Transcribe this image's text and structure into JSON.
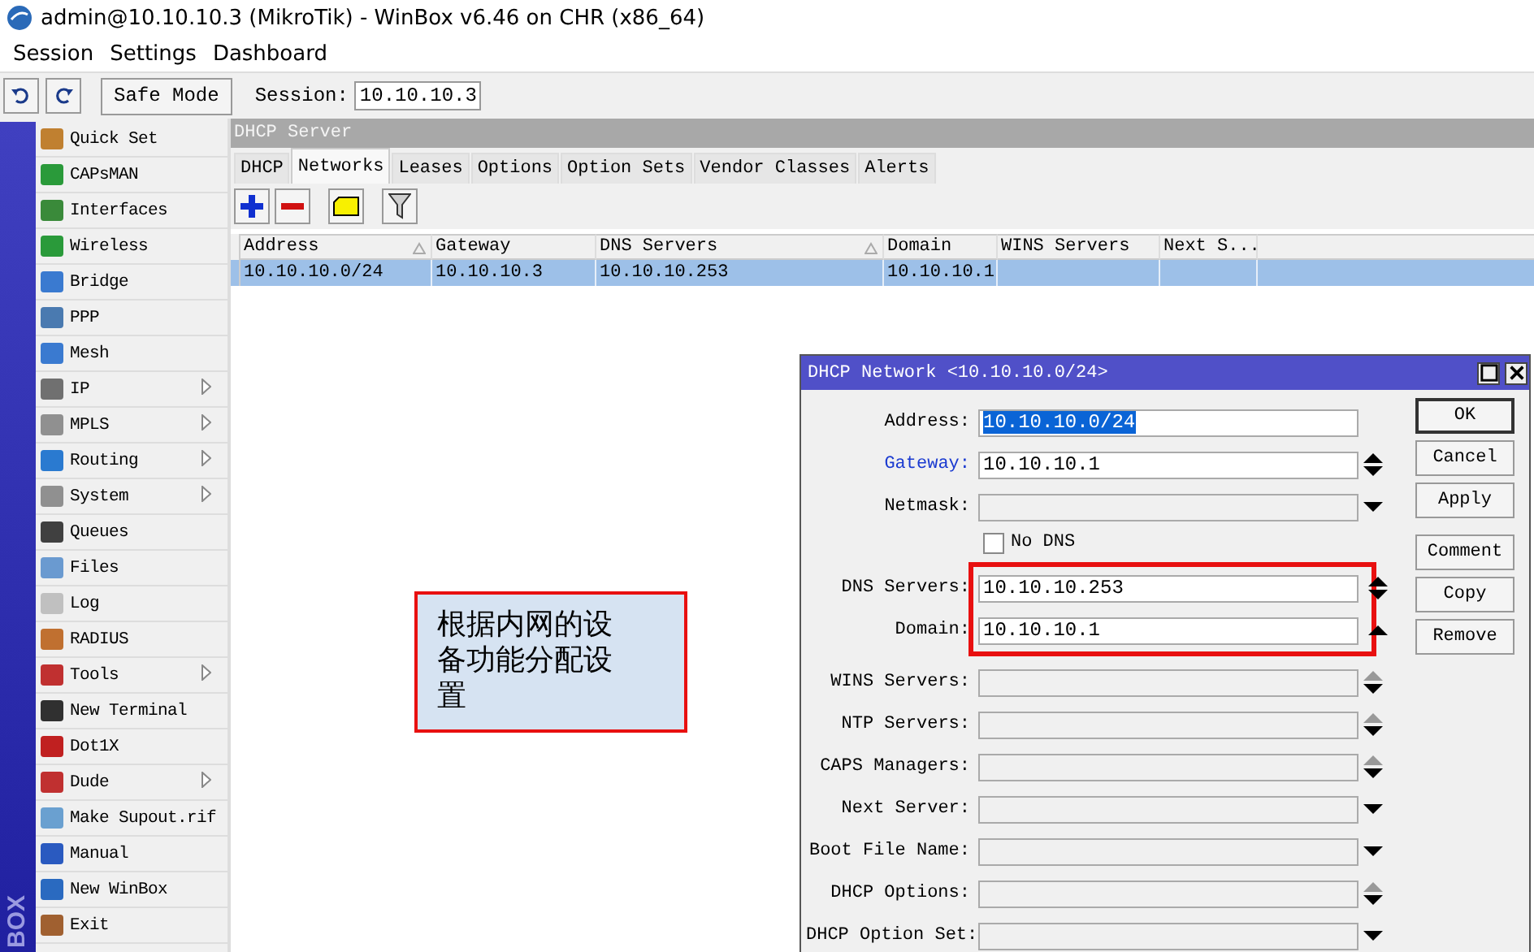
{
  "window": {
    "title": "admin@10.10.10.3 (MikroTik) - WinBox v6.46 on CHR (x86_64)"
  },
  "menu": [
    "Session",
    "Settings",
    "Dashboard"
  ],
  "toolbar": {
    "safe_mode": "Safe Mode",
    "session_label": "Session:",
    "session_value": "10.10.10.3"
  },
  "sidebar": {
    "brand": "BOX",
    "items": [
      {
        "label": "Quick Set",
        "submenu": false
      },
      {
        "label": "CAPsMAN",
        "submenu": false
      },
      {
        "label": "Interfaces",
        "submenu": false
      },
      {
        "label": "Wireless",
        "submenu": false
      },
      {
        "label": "Bridge",
        "submenu": false
      },
      {
        "label": "PPP",
        "submenu": false
      },
      {
        "label": "Mesh",
        "submenu": false
      },
      {
        "label": "IP",
        "submenu": true
      },
      {
        "label": "MPLS",
        "submenu": true
      },
      {
        "label": "Routing",
        "submenu": true
      },
      {
        "label": "System",
        "submenu": true
      },
      {
        "label": "Queues",
        "submenu": false
      },
      {
        "label": "Files",
        "submenu": false
      },
      {
        "label": "Log",
        "submenu": false
      },
      {
        "label": "RADIUS",
        "submenu": false
      },
      {
        "label": "Tools",
        "submenu": true
      },
      {
        "label": "New Terminal",
        "submenu": false
      },
      {
        "label": "Dot1X",
        "submenu": false
      },
      {
        "label": "Dude",
        "submenu": true
      },
      {
        "label": "Make Supout.rif",
        "submenu": false
      },
      {
        "label": "Manual",
        "submenu": false
      },
      {
        "label": "New WinBox",
        "submenu": false
      },
      {
        "label": "Exit",
        "submenu": false
      }
    ]
  },
  "panel": {
    "title": "DHCP Server",
    "tabs": [
      {
        "label": "DHCP",
        "selected": false
      },
      {
        "label": "Networks",
        "selected": true
      },
      {
        "label": "Leases",
        "selected": false
      },
      {
        "label": "Options",
        "selected": false
      },
      {
        "label": "Option Sets",
        "selected": false
      },
      {
        "label": "Vendor Classes",
        "selected": false
      },
      {
        "label": "Alerts",
        "selected": false
      }
    ],
    "table": {
      "columns": [
        {
          "label": "Address",
          "sorted": true
        },
        {
          "label": "Gateway",
          "sorted": false
        },
        {
          "label": "DNS Servers",
          "sorted": true
        },
        {
          "label": "Domain",
          "sorted": false
        },
        {
          "label": "WINS Servers",
          "sorted": false
        },
        {
          "label": "Next S...",
          "sorted": false
        }
      ],
      "rows": [
        {
          "selected": true,
          "cells": [
            "10.10.10.0/24",
            "10.10.10.3",
            "10.10.10.253",
            "10.10.10.1",
            "",
            ""
          ]
        }
      ]
    }
  },
  "callout": {
    "text": "根据内网的设备功能分配设置"
  },
  "dialog": {
    "title": "DHCP Network <10.10.10.0/24>",
    "sections": [
      {
        "highlighted": false,
        "fields": [
          {
            "kind": "text",
            "label": "Address:",
            "link": false,
            "value": "10.10.10.0/24",
            "value_selected": true,
            "enabled": true,
            "up_arrow": false,
            "down_arrow": false
          },
          {
            "kind": "text",
            "label": "Gateway:",
            "link": true,
            "value": "10.10.10.1",
            "value_selected": false,
            "enabled": true,
            "up_arrow": true,
            "up_enabled": true,
            "down_arrow": true
          },
          {
            "kind": "text",
            "label": "Netmask:",
            "link": false,
            "enabled": false,
            "up_arrow": false,
            "down_arrow": true
          },
          {
            "kind": "checkbox",
            "label": "No DNS",
            "checked": false
          }
        ]
      },
      {
        "highlighted": true,
        "fields": [
          {
            "kind": "text",
            "label": "DNS Servers:",
            "link": false,
            "value": "10.10.10.253",
            "value_selected": false,
            "enabled": true,
            "up_arrow": true,
            "up_enabled": true,
            "down_arrow": true
          },
          {
            "kind": "text",
            "label": "Domain:",
            "link": false,
            "value": "10.10.10.1",
            "value_selected": false,
            "enabled": true,
            "up_arrow": true,
            "up_enabled": true,
            "down_arrow": false
          }
        ]
      },
      {
        "highlighted": false,
        "fields": [
          {
            "kind": "text",
            "label": "WINS Servers:",
            "link": false,
            "enabled": false,
            "up_arrow": true,
            "up_enabled": false,
            "down_arrow": true
          },
          {
            "kind": "text",
            "label": "NTP Servers:",
            "link": false,
            "enabled": false,
            "up_arrow": true,
            "up_enabled": false,
            "down_arrow": true
          },
          {
            "kind": "text",
            "label": "CAPS Managers:",
            "link": false,
            "enabled": false,
            "up_arrow": true,
            "up_enabled": false,
            "down_arrow": true
          },
          {
            "kind": "text",
            "label": "Next Server:",
            "link": false,
            "enabled": false,
            "up_arrow": false,
            "down_arrow": true
          },
          {
            "kind": "text",
            "label": "Boot File Name:",
            "link": false,
            "enabled": false,
            "up_arrow": false,
            "down_arrow": true
          },
          {
            "kind": "text",
            "label": "DHCP Options:",
            "link": false,
            "enabled": false,
            "up_arrow": true,
            "up_enabled": false,
            "down_arrow": true
          },
          {
            "kind": "text",
            "label": "DHCP Option Set:",
            "link": false,
            "enabled": false,
            "up_arrow": false,
            "down_arrow": true
          }
        ]
      }
    ],
    "button_groups": [
      [
        {
          "label": "OK",
          "default": true
        },
        {
          "label": "Cancel",
          "default": false
        },
        {
          "label": "Apply",
          "default": false
        }
      ],
      [
        {
          "label": "Comment",
          "default": false
        },
        {
          "label": "Copy",
          "default": false
        },
        {
          "label": "Remove",
          "default": false
        }
      ]
    ]
  }
}
